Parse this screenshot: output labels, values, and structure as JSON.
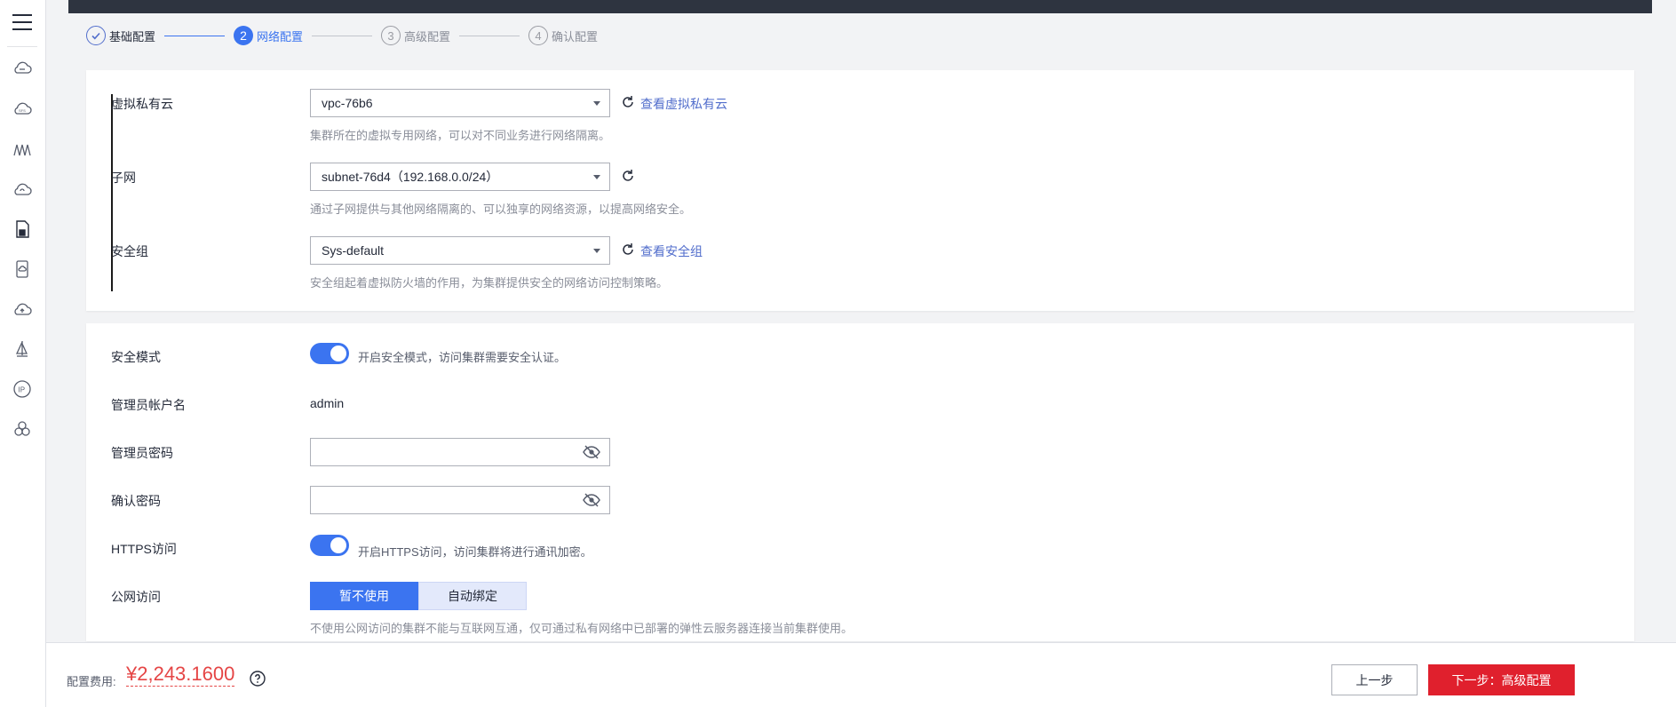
{
  "sidebar": {
    "menu_icon": "hamburger-menu-icon",
    "items": [
      {
        "icon": "cloud-service-icon"
      },
      {
        "icon": "cloud-sfs-icon"
      },
      {
        "icon": "nodes-icon"
      },
      {
        "icon": "cloud-sync-icon"
      },
      {
        "icon": "document-chart-icon"
      },
      {
        "icon": "device-cloud-icon"
      },
      {
        "icon": "cloud-upload-icon"
      },
      {
        "icon": "sail-icon"
      },
      {
        "icon": "ip-icon"
      },
      {
        "icon": "cluster-circles-icon"
      }
    ]
  },
  "steps": [
    {
      "number": "",
      "label": "基础配置",
      "state": "done"
    },
    {
      "number": "2",
      "label": "网络配置",
      "state": "active"
    },
    {
      "number": "3",
      "label": "高级配置",
      "state": "todo"
    },
    {
      "number": "4",
      "label": "确认配置",
      "state": "todo"
    }
  ],
  "network": {
    "vpc": {
      "label": "虚拟私有云",
      "value": "vpc-76b6",
      "link": "查看虚拟私有云",
      "hint": "集群所在的虚拟专用网络，可以对不同业务进行网络隔离。"
    },
    "subnet": {
      "label": "子网",
      "value": "subnet-76d4（192.168.0.0/24）",
      "hint": "通过子网提供与其他网络隔离的、可以独享的网络资源，以提高网络安全。"
    },
    "security_group": {
      "label": "安全组",
      "value": "Sys-default",
      "link": "查看安全组",
      "hint": "安全组起着虚拟防火墙的作用，为集群提供安全的网络访问控制策略。"
    }
  },
  "security": {
    "mode": {
      "label": "安全模式",
      "enabled": true,
      "text": "开启安全模式，访问集群需要安全认证。"
    },
    "admin_account": {
      "label": "管理员帐户名",
      "value": "admin"
    },
    "admin_password": {
      "label": "管理员密码",
      "value": ""
    },
    "confirm_password": {
      "label": "确认密码",
      "value": ""
    },
    "https": {
      "label": "HTTPS访问",
      "enabled": true,
      "text": "开启HTTPS访问，访问集群将进行通讯加密。"
    },
    "public_access": {
      "label": "公网访问",
      "options": [
        "暂不使用",
        "自动绑定"
      ],
      "selected": "暂不使用",
      "hint": "不使用公网访问的集群不能与互联网互通，仅可通过私有网络中已部署的弹性云服务器连接当前集群使用。"
    }
  },
  "footer": {
    "fee_label": "配置费用:",
    "fee_value": "¥2,243.1600",
    "prev_label": "上一步",
    "next_label": "下一步：高级配置"
  },
  "colors": {
    "primary": "#3b74f0",
    "danger": "#e0202d",
    "price": "#e54545"
  }
}
